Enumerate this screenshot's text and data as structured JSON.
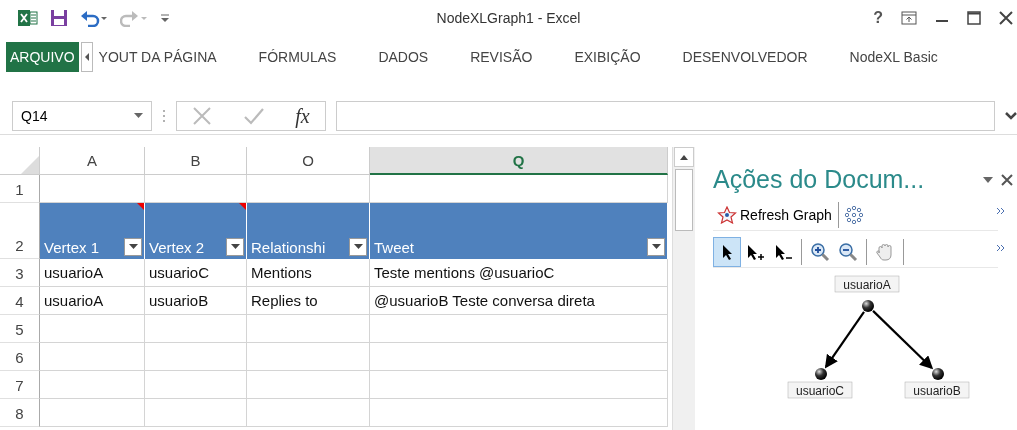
{
  "window": {
    "title": "NodeXLGraph1 - Excel",
    "help": "?"
  },
  "ribbon_tabs": [
    {
      "label": "ARQUIVO",
      "kind": "file"
    },
    {
      "label": "YOUT DA PÁGINA",
      "kind": "tab"
    },
    {
      "label": "FÓRMULAS",
      "kind": "tab"
    },
    {
      "label": "DADOS",
      "kind": "tab"
    },
    {
      "label": "REVISÃO",
      "kind": "tab"
    },
    {
      "label": "EXIBIÇÃO",
      "kind": "tab"
    },
    {
      "label": "DESENVOLVEDOR",
      "kind": "tab"
    },
    {
      "label": "NodeXL Basic",
      "kind": "tab"
    }
  ],
  "formula_bar": {
    "name_box": "Q14",
    "function_label": "fx"
  },
  "sheet": {
    "columns": [
      {
        "label": "A",
        "selected": false
      },
      {
        "label": "B",
        "selected": false
      },
      {
        "label": "O",
        "selected": false
      },
      {
        "label": "Q",
        "selected": true
      }
    ],
    "rows": [
      {
        "number": "1",
        "kind": "blank",
        "cells": []
      },
      {
        "number": "2",
        "kind": "header",
        "cells": [
          {
            "text": "Vertex 1",
            "comment": true
          },
          {
            "text": "Vertex 2",
            "comment": true
          },
          {
            "text": "Relationshi",
            "comment": false
          },
          {
            "text": "Tweet",
            "comment": false
          }
        ]
      },
      {
        "number": "3",
        "kind": "data",
        "cells": [
          {
            "text": "usuarioA"
          },
          {
            "text": "usuarioC"
          },
          {
            "text": "Mentions"
          },
          {
            "text": "Teste mentions @usuarioC"
          }
        ]
      },
      {
        "number": "4",
        "kind": "data",
        "cells": [
          {
            "text": "usuarioA"
          },
          {
            "text": "usuarioB"
          },
          {
            "text": "Replies to"
          },
          {
            "text": "@usuarioB Teste conversa direta"
          }
        ]
      },
      {
        "number": "5",
        "kind": "blank",
        "cells": []
      },
      {
        "number": "6",
        "kind": "blank",
        "cells": []
      },
      {
        "number": "7",
        "kind": "blank",
        "cells": []
      },
      {
        "number": "8",
        "kind": "blank",
        "cells": []
      }
    ]
  },
  "task_pane": {
    "title": "Ações do Docum...",
    "refresh_button": "Refresh Graph",
    "tools": [
      {
        "kind": "select",
        "selected": true
      },
      {
        "kind": "add",
        "selected": false
      },
      {
        "kind": "remove",
        "selected": false
      },
      {
        "kind": "zoom-in",
        "selected": false
      },
      {
        "kind": "zoom-out",
        "selected": false
      },
      {
        "kind": "pan",
        "selected": false
      }
    ],
    "graph": {
      "nodes": [
        {
          "label": "usuarioA"
        },
        {
          "label": "usuarioC"
        },
        {
          "label": "usuarioB"
        }
      ]
    }
  }
}
